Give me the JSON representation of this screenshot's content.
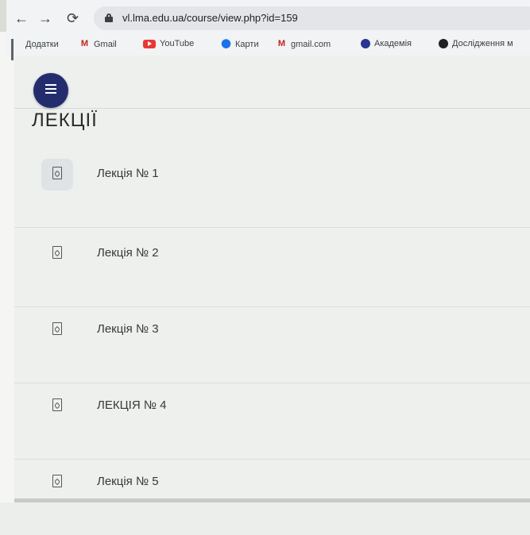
{
  "browser": {
    "url": "vl.lma.edu.ua/course/view.php?id=159",
    "bookmarks": [
      {
        "label": "Додатки",
        "icon": "apps-icon"
      },
      {
        "label": "Gmail",
        "icon": "gmail-icon"
      },
      {
        "label": "YouTube",
        "icon": "youtube-icon"
      },
      {
        "label": "Карти",
        "icon": "maps-pin-icon"
      },
      {
        "label": "gmail.com",
        "icon": "gmail-icon"
      },
      {
        "label": "Академія",
        "icon": "academy-icon"
      },
      {
        "label": "Дослідження м",
        "icon": "globe-icon"
      }
    ]
  },
  "course": {
    "section_title": "ЛЕКЦІЇ",
    "items": [
      {
        "label": "Лекція № 1",
        "icon": "pdf-file-icon"
      },
      {
        "label": "Лекція № 2",
        "icon": "pdf-file-icon"
      },
      {
        "label": "Лекція № 3",
        "icon": "pdf-file-icon"
      },
      {
        "label": "ЛЕКЦІЯ № 4",
        "icon": "pdf-file-icon"
      },
      {
        "label": "Лекція № 5",
        "icon": "pdf-file-icon"
      }
    ]
  },
  "colors": {
    "fab_background": "#232d6e",
    "page_background": "#eef0ee"
  }
}
